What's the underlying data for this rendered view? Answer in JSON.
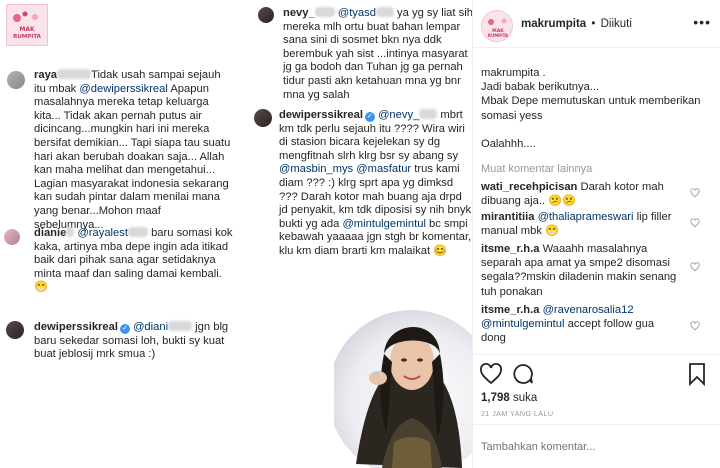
{
  "collage": {
    "logo_text": "MAK RUMPITA",
    "comment1": {
      "user": "raya",
      "text_a": "Tidak usah sampai sejauh itu mbak ",
      "mention": "@dewiperssikreal",
      "text_b": " Apapun masalahnya mereka tetap keluarga kita... Tidak akan pernah putus air dicincang...mungkin hari ini mereka bersifat demikian... Tapi siapa tau suatu hari akan berubah doakan saja... Allah kan maha melihat dan mengetahui... Lagian masyarakat indonesia sekarang kan sudah pintar dalam menilai mana yang benar...Mohon maaf sebelumnya..."
    },
    "comment2": {
      "user": "dianie",
      "mention": "@rayalest",
      "text": " baru somasi kok kaka, artinya mba depe ingin ada itikad baik dari pihak sana agar setidaknya minta maaf dan saling damai kembali. 😁"
    },
    "comment3": {
      "user": "dewiperssikreal",
      "mention": "@diani",
      "text": " jgn blg baru sekedar somasi loh, bukti sy kuat buat jeblosij mrk smua :)"
    },
    "comment4": {
      "user": "nevy_",
      "mention": "@tyasd",
      "text": " ya yg sy liat sih mereka mlh ortu buat bahan lempar sana sini di sosmet bkn nya ddk berembuk yah  sist ...intinya masyarat jg ga bodoh dan Tuhan jg ga pernah tidur pasti akn ketahuan mna yg bnr mna yg salah"
    },
    "comment5": {
      "user": "dewiperssikreal",
      "mention1": "@nevy_",
      "text1": " mbrt km tdk perlu sejauh itu ???? Wira wiri di stasion bicara kejelekan sy dg mengfitnah slrh klrg bsr sy abang sy ",
      "mention2": "@masbin_mys",
      "mention3": "@masfatur",
      "text2": " trus kami diam ??? :) klrg sprt apa yg dimksd ??? Darah kotor mah buang aja drpd jd penyakit, km tdk diposisi sy nih bnyk bukti yg ada ",
      "mention4": "@mintulgemintul",
      "text3": " bc smpi kebawah yaaaaa jgn stgh br komentar, klu km diam brarti km malaikat 😊"
    }
  },
  "panel": {
    "username": "makrumpita",
    "dot": "•",
    "follow_status": "Diikuti",
    "more": "•••",
    "caption_user": "makrumpita",
    "caption_lines": [
      "makrumpita .",
      "Jadi babak berikutnya...",
      "Mbak Depe memutuskan untuk memberikan somasi yess",
      "Oalahhh...."
    ],
    "load_more": "Muat komentar lainnya",
    "comments": [
      {
        "user": "wati_recehpicisan",
        "text": " Darah kotor mah dibuang aja.. 😕😕"
      },
      {
        "user": "mirantitiia",
        "mention": "@thaliaprameswari",
        "text": " lip filler manual mbk 😁"
      },
      {
        "user": "itsme_r.h.a",
        "text": " Waaahh masalahnya separah apa amat ya smpe2 disomasi segala??mskin diladenin makin senang tuh ponakan"
      },
      {
        "user": "itsme_r.h.a",
        "mention": "@ravenarosalia12",
        "mention2": "@mintulgemintul",
        "text": " accept follow gua dong"
      }
    ],
    "likes_count": "1,798",
    "likes_label": "suka",
    "timestamp": "21 JAM YANG LALU",
    "add_comment_placeholder": "Tambahkan komentar..."
  }
}
